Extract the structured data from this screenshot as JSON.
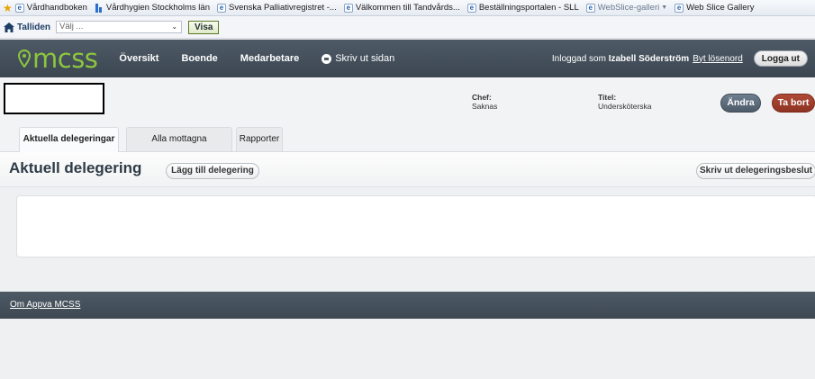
{
  "browser": {
    "favorites": [
      {
        "label": "Vårdhandboken",
        "icon": "ie-page-icon"
      },
      {
        "label": "Vårdhygien Stockholms län",
        "icon": "vardhygien-icon"
      },
      {
        "label": "Svenska Palliativregistret -...",
        "icon": "ie-page-icon"
      },
      {
        "label": "Välkommen till Tandvårds...",
        "icon": "ie-page-icon"
      },
      {
        "label": "Beställningsportalen - SLL",
        "icon": "ie-page-icon"
      },
      {
        "label": "WebSlice-galleri",
        "icon": "ie-page-icon",
        "dropdown": true
      },
      {
        "label": "Web Slice Gallery",
        "icon": "ie-page-icon"
      }
    ],
    "home_label": "Talliden",
    "select_placeholder": "Välj ...",
    "visa_label": "Visa"
  },
  "nav": {
    "logo": "mcss",
    "items": [
      "Översikt",
      "Boende",
      "Medarbetare"
    ],
    "print_label": "Skriv ut sidan",
    "logged_in_prefix": "Inloggad som",
    "user_name": "Izabell Söderström",
    "change_password": "Byt lösenord",
    "logout": "Logga ut"
  },
  "person": {
    "chef_label": "Chef:",
    "chef_value": "Saknas",
    "titel_label": "Titel:",
    "titel_value": "Undersköterska",
    "edit_label": "Ändra",
    "delete_label": "Ta bort"
  },
  "tabs": [
    "Aktuella delegeringar",
    "Alla mottagna delegeringar",
    "Rapporter"
  ],
  "section": {
    "title": "Aktuell delegering",
    "add_label": "Lägg till delegering",
    "print_label": "Skriv ut delegeringsbeslut"
  },
  "footer": {
    "link": "Om Appva MCSS"
  },
  "colors": {
    "nav_bg": "#434e59",
    "logo_green": "#8cc63f",
    "delete_red": "#9c3b2a",
    "edit_gray": "#5d6b7a"
  }
}
